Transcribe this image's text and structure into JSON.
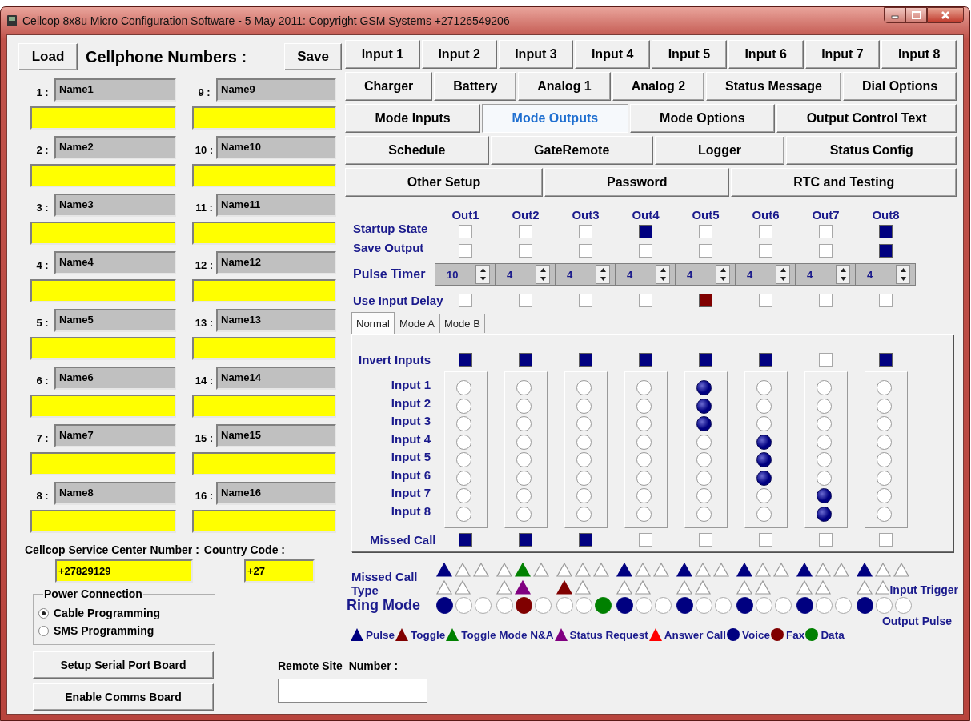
{
  "window": {
    "title": "Cellcop 8x8u Micro Configuration Software - 5 May 2011: Copyright GSM Systems +27126549206"
  },
  "cellphone": {
    "load": "Load",
    "title": "Cellphone Numbers :",
    "save": "Save",
    "entries": [
      {
        "index": "1 :",
        "name": "Name1"
      },
      {
        "index": "2 :",
        "name": "Name2"
      },
      {
        "index": "3 :",
        "name": "Name3"
      },
      {
        "index": "4 :",
        "name": "Name4"
      },
      {
        "index": "5 :",
        "name": "Name5"
      },
      {
        "index": "6 :",
        "name": "Name6"
      },
      {
        "index": "7 :",
        "name": "Name7"
      },
      {
        "index": "8 :",
        "name": "Name8"
      },
      {
        "index": "9 :",
        "name": "Name9"
      },
      {
        "index": "10 :",
        "name": "Name10"
      },
      {
        "index": "11 :",
        "name": "Name11"
      },
      {
        "index": "12 :",
        "name": "Name12"
      },
      {
        "index": "13 :",
        "name": "Name13"
      },
      {
        "index": "14 :",
        "name": "Name14"
      },
      {
        "index": "15 :",
        "name": "Name15"
      },
      {
        "index": "16 :",
        "name": "Name16"
      }
    ]
  },
  "service_center": {
    "label": "Cellcop Service Center Number :",
    "value": "+27829129"
  },
  "country_code": {
    "label": "Country Code :",
    "value": "+27"
  },
  "power_connection": {
    "title": "Power Connection",
    "options": [
      {
        "label": "Cable Programming",
        "selected": true
      },
      {
        "label": "SMS Programming",
        "selected": false
      }
    ]
  },
  "buttons": [
    "Setup Serial Port Board",
    "Enable Comms Board"
  ],
  "remote_site": {
    "label": "Remote Site  Number :"
  },
  "tab_rows": [
    [
      {
        "label": "Input 1",
        "selected": false
      },
      {
        "label": "Input 2",
        "selected": false
      },
      {
        "label": "Input 3",
        "selected": false
      },
      {
        "label": "Input 4",
        "selected": false
      },
      {
        "label": "Input 5",
        "selected": false
      },
      {
        "label": "Input 6",
        "selected": false
      },
      {
        "label": "Input 7",
        "selected": false
      },
      {
        "label": "Input 8",
        "selected": false
      }
    ],
    [
      {
        "label": "Charger",
        "selected": false
      },
      {
        "label": "Battery",
        "selected": false
      },
      {
        "label": "Analog 1",
        "selected": false
      },
      {
        "label": "Analog 2",
        "selected": false
      },
      {
        "label": "Status Message",
        "selected": false
      },
      {
        "label": "Dial Options",
        "selected": false
      }
    ],
    [
      {
        "label": "Mode Inputs",
        "selected": false
      },
      {
        "label": "Mode Outputs",
        "selected": true
      },
      {
        "label": "Mode Options",
        "selected": false
      },
      {
        "label": "Output Control Text",
        "selected": false
      }
    ],
    [
      {
        "label": "Schedule",
        "selected": false
      },
      {
        "label": "GateRemote",
        "selected": false
      },
      {
        "label": "Logger",
        "selected": false
      },
      {
        "label": "Status Config",
        "selected": false
      }
    ],
    [
      {
        "label": "Other Setup",
        "selected": false
      },
      {
        "label": "Password",
        "selected": false
      },
      {
        "label": "RTC and Testing",
        "selected": false
      }
    ]
  ],
  "row_labels": {
    "startup": "Startup State",
    "save": "Save Output",
    "pulse": "Pulse Timer",
    "delay": "Use Input Delay",
    "invert": "Invert Inputs",
    "missed": "Missed Call",
    "call_type": "Missed Call Type",
    "ring": "Ring Mode"
  },
  "sub_tabs": [
    {
      "label": "Normal",
      "selected": true
    },
    {
      "label": "Mode A",
      "selected": false
    },
    {
      "label": "Mode B",
      "selected": false
    }
  ],
  "input_labels": [
    "Input 1",
    "Input 2",
    "Input 3",
    "Input 4",
    "Input 5",
    "Input 6",
    "Input 7",
    "Input 8"
  ],
  "outputs": [
    {
      "label": "Out1",
      "startup": false,
      "save": false,
      "pulse": "10",
      "delay": false,
      "invert": true,
      "inputs": [
        false,
        false,
        false,
        false,
        false,
        false,
        false,
        false
      ],
      "missed": true,
      "call_types": [
        true,
        false,
        false,
        false,
        false
      ],
      "ring": [
        true,
        false,
        false
      ]
    },
    {
      "label": "Out2",
      "startup": false,
      "save": false,
      "pulse": "4",
      "delay": false,
      "invert": true,
      "inputs": [
        false,
        false,
        false,
        false,
        false,
        false,
        false,
        false
      ],
      "missed": true,
      "call_types": [
        false,
        false,
        true,
        true,
        false
      ],
      "ring": [
        false,
        true,
        false
      ]
    },
    {
      "label": "Out3",
      "startup": false,
      "save": false,
      "pulse": "4",
      "delay": false,
      "invert": true,
      "inputs": [
        false,
        false,
        false,
        false,
        false,
        false,
        false,
        false
      ],
      "missed": true,
      "call_types": [
        false,
        true,
        false,
        false,
        false
      ],
      "ring": [
        false,
        false,
        true
      ]
    },
    {
      "label": "Out4",
      "startup": true,
      "save": false,
      "pulse": "4",
      "delay": false,
      "invert": true,
      "inputs": [
        false,
        false,
        false,
        false,
        false,
        false,
        false,
        false
      ],
      "missed": false,
      "call_types": [
        true,
        false,
        false,
        false,
        false
      ],
      "ring": [
        true,
        false,
        false
      ]
    },
    {
      "label": "Out5",
      "startup": false,
      "save": false,
      "pulse": "4",
      "delay": true,
      "invert": true,
      "inputs": [
        true,
        true,
        true,
        false,
        false,
        false,
        false,
        false
      ],
      "missed": false,
      "call_types": [
        true,
        false,
        false,
        false,
        false
      ],
      "ring": [
        true,
        false,
        false
      ]
    },
    {
      "label": "Out6",
      "startup": false,
      "save": false,
      "pulse": "4",
      "delay": false,
      "invert": true,
      "inputs": [
        false,
        false,
        false,
        true,
        true,
        true,
        false,
        false
      ],
      "missed": false,
      "call_types": [
        true,
        false,
        false,
        false,
        false
      ],
      "ring": [
        true,
        false,
        false
      ]
    },
    {
      "label": "Out7",
      "startup": false,
      "save": false,
      "pulse": "4",
      "delay": false,
      "invert": false,
      "inputs": [
        false,
        false,
        false,
        false,
        false,
        false,
        true,
        true
      ],
      "missed": false,
      "call_types": [
        true,
        false,
        false,
        false,
        false
      ],
      "ring": [
        true,
        false,
        false
      ]
    },
    {
      "label": "Out8",
      "startup": true,
      "save": true,
      "pulse": "4",
      "delay": false,
      "invert": true,
      "inputs": [
        false,
        false,
        false,
        false,
        false,
        false,
        false,
        false
      ],
      "missed": false,
      "call_types": [
        true,
        false,
        false,
        false,
        false
      ],
      "ring": [
        true,
        false,
        false
      ]
    }
  ],
  "overlay_labels": [
    "Input Trigger",
    "Output Pulse"
  ],
  "legend": [
    {
      "kind": "triangle",
      "label": "Pulse",
      "color": "#000080"
    },
    {
      "kind": "triangle",
      "label": "Toggle",
      "color": "#800000"
    },
    {
      "kind": "triangle",
      "label": "Toggle Mode N&A",
      "color": "#008000"
    },
    {
      "kind": "triangle",
      "label": "Status Request",
      "color": "#800080"
    },
    {
      "kind": "triangle",
      "label": "Answer Call",
      "color": "#ff0000"
    },
    {
      "kind": "circle",
      "label": "Voice",
      "color": "#000080"
    },
    {
      "kind": "circle",
      "label": "Fax",
      "color": "#800000"
    },
    {
      "kind": "circle",
      "label": "Data",
      "color": "#008000"
    }
  ]
}
